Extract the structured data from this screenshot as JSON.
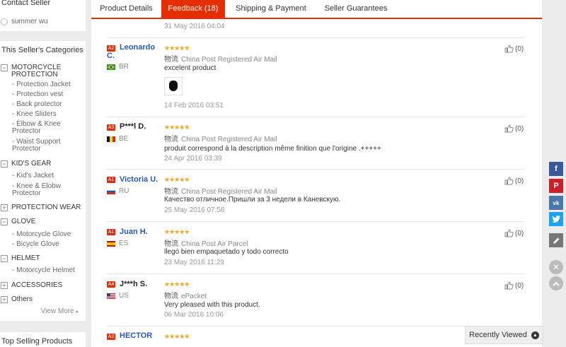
{
  "sidebar": {
    "contact_title": "Contact Seller",
    "seller_name": "summer wu",
    "categories_title": "This Seller's Categories",
    "categories": [
      {
        "label": "MOTORCYCLE PROTECTION",
        "toggle": "−",
        "subs": [
          "- Protection Jacket",
          "- Protection vest",
          "- Back protector",
          "- Knee Sliders",
          "- Elbow & Knee Protector",
          "- Waist Support Protector"
        ]
      },
      {
        "label": "KID'S GEAR",
        "toggle": "−",
        "subs": [
          "- Kid's Jacket",
          "-  Knee & Elobw Protector"
        ]
      },
      {
        "label": "PROTECTION WEAR",
        "toggle": "+",
        "subs": []
      },
      {
        "label": "GLOVE",
        "toggle": "−",
        "subs": [
          "- Motorcycle Glove",
          "- Bicycle Glove"
        ]
      },
      {
        "label": "HELMET",
        "toggle": "−",
        "subs": [
          "- Motorcycle Helmet"
        ]
      },
      {
        "label": "ACCESSORIES",
        "toggle": "+",
        "subs": []
      },
      {
        "label": "Others",
        "toggle": "+",
        "subs": []
      }
    ],
    "view_more": "View More",
    "top_selling_title": "Top Selling Products"
  },
  "tabs": [
    {
      "label": "Product Details"
    },
    {
      "label": "Feedback (18)"
    },
    {
      "label": "Shipping & Payment"
    },
    {
      "label": "Seller Guarantees"
    }
  ],
  "top_date": "31 May 2016 04:04",
  "feedback": [
    {
      "level": "A2",
      "name_line1": "Leonardo",
      "name_line2": "C.",
      "country": "BR",
      "stars": "★★★★★",
      "ship_zh": "物流",
      "ship": "China Post Registered Air Mail",
      "comment": "excelent product",
      "date": "14 Feb 2016 03:51",
      "likes": "(0)"
    },
    {
      "level": "A3",
      "name_line1": "P***l D.",
      "name_line2": "",
      "country": "BE",
      "stars": "★★★★★",
      "ship_zh": "物流",
      "ship": "China Post Registered Air Mail",
      "comment": "produit correspond à la description même finition que l'origine .+++++",
      "date": "24 Apr 2016 03:39",
      "likes": "(0)"
    },
    {
      "level": "A1",
      "name_line1": "Victoria U.",
      "name_line2": "",
      "country": "RU",
      "stars": "★★★★★",
      "ship_zh": "物流",
      "ship": "China Post Registered Air Mail",
      "comment": "Качество отличное.Пришли за 3 недели в Каневскую.",
      "date": "25 May 2016 07:56",
      "likes": "(0)"
    },
    {
      "level": "A1",
      "name_line1": "Juan H.",
      "name_line2": "",
      "country": "ES",
      "stars": "★★★★★",
      "ship_zh": "物流",
      "ship": "China Post Air Parcel",
      "comment": "llegó bien empaquetado y todo correcto",
      "date": "23 May 2016 11:29",
      "likes": "(0)"
    },
    {
      "level": "A4",
      "name_line1": "J***h S.",
      "name_line2": "",
      "country": "US",
      "stars": "★★★★★",
      "ship_zh": "物流",
      "ship": "ePacket",
      "comment": "Very pleased with this product.",
      "date": "06 Mar 2016 10:06",
      "likes": "(0)"
    },
    {
      "level": "A3",
      "name_line1": "HECTOR",
      "name_line2": "",
      "country": "",
      "stars": "★★★★★",
      "ship_zh": "",
      "ship": "",
      "comment": "",
      "date": "",
      "likes": ""
    }
  ],
  "recently_viewed": "Recently Viewed",
  "colors": {
    "accent": "#e62e04",
    "star": "#f5a623",
    "link": "#2a5aa8"
  }
}
